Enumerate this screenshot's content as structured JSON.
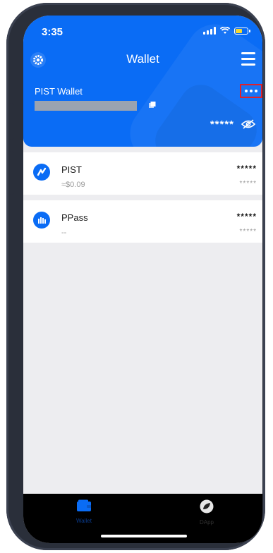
{
  "status_bar": {
    "time": "3:35"
  },
  "header": {
    "title": "Wallet"
  },
  "wallet": {
    "name": "PIST Wallet",
    "balance_masked": "*****"
  },
  "tokens": [
    {
      "name": "PIST",
      "price": "≈$0.09",
      "amount": "*****",
      "value": "*****"
    },
    {
      "name": "PPass",
      "price": "--",
      "amount": "*****",
      "value": "*****"
    }
  ],
  "tabbar": {
    "tabs": [
      {
        "label": "Wallet",
        "icon": "wallet-icon",
        "active": true
      },
      {
        "label": "DApp",
        "icon": "dapp-icon",
        "active": false
      }
    ]
  },
  "colors": {
    "primary": "#0a6cf5",
    "highlight_border": "#e0212b",
    "background": "#ededf0",
    "tabbar": "#000000"
  }
}
